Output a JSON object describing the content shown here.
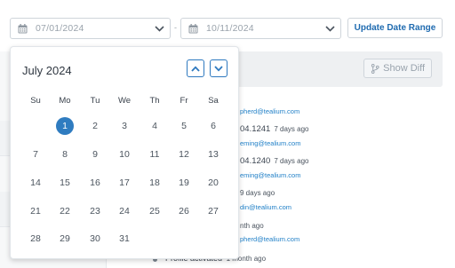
{
  "filters": {
    "start_date": "07/01/2024",
    "end_date": "10/11/2024",
    "separator": "-",
    "update_button": "Update Date Range"
  },
  "history": {
    "show_diff": "Show Diff",
    "entries": [
      {
        "email": "pherd@tealium.com"
      },
      {
        "version": "04.1241",
        "ago": "7 days ago",
        "email": "eming@tealium.com"
      },
      {
        "version": "04.1240",
        "ago": "7 days ago",
        "email": "eming@tealium.com"
      },
      {
        "ago": "9 days ago",
        "email": "din@tealium.com"
      },
      {
        "ago": "nth ago",
        "email": "pherd@tealium.com"
      },
      {
        "title": "Profile activated",
        "ago": "1 month ago"
      }
    ]
  },
  "calendar": {
    "month_label": "July 2024",
    "weekdays": [
      "Su",
      "Mo",
      "Tu",
      "We",
      "Th",
      "Fr",
      "Sa"
    ],
    "weeks": [
      [
        "",
        "1",
        "2",
        "3",
        "4",
        "5",
        "6"
      ],
      [
        "7",
        "8",
        "9",
        "10",
        "11",
        "12",
        "13"
      ],
      [
        "14",
        "15",
        "16",
        "17",
        "18",
        "19",
        "20"
      ],
      [
        "21",
        "22",
        "23",
        "24",
        "25",
        "26",
        "27"
      ],
      [
        "28",
        "29",
        "30",
        "31",
        "",
        "",
        ""
      ]
    ],
    "selected_day": "1"
  },
  "colors": {
    "accent": "#2f7cc0",
    "link": "#1f7fc7"
  },
  "icons": {
    "date_field": "calendar-icon",
    "dropdown": "chevron-down-icon",
    "prev_month": "chevron-up-icon",
    "next_month": "chevron-down-icon",
    "diff": "branch-icon"
  }
}
